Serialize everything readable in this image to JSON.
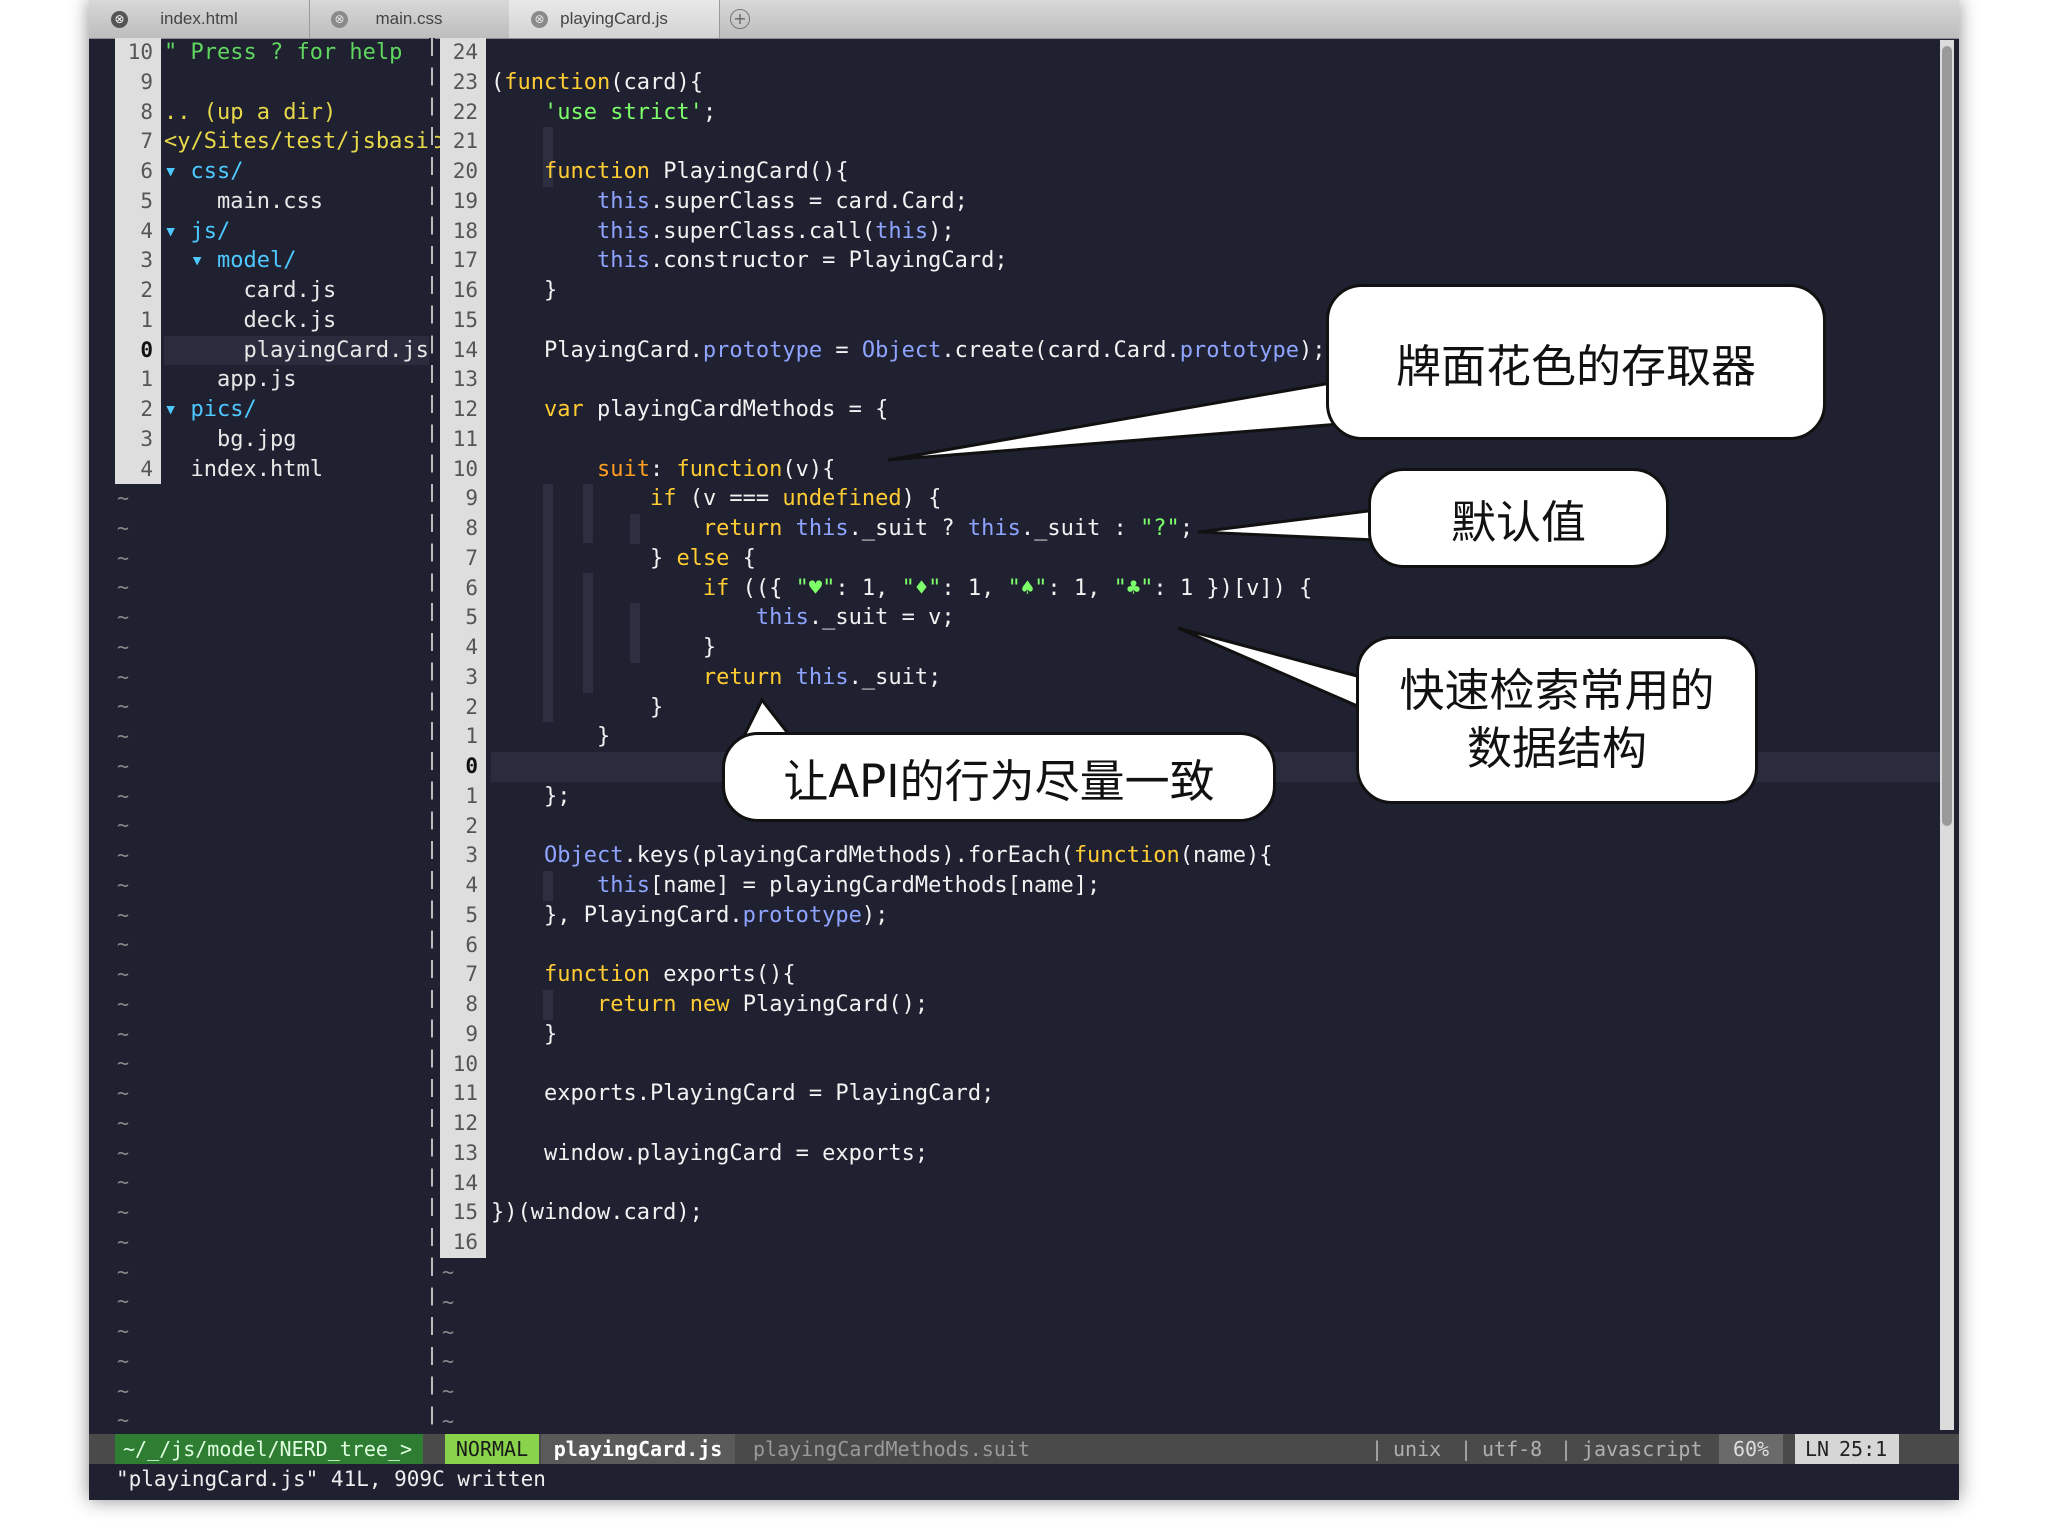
{
  "tabs": [
    {
      "label": "index.html",
      "active": false
    },
    {
      "label": "main.css",
      "active": false
    },
    {
      "label": "playingCard.js",
      "active": true
    }
  ],
  "tab_close_glyph": "⊗",
  "new_tab_glyph": "+",
  "tree": {
    "line_numbers": [
      "10",
      "9",
      "8",
      "7",
      "6",
      "5",
      "4",
      "3",
      "2",
      "1",
      "0",
      "1",
      "2",
      "3",
      "4"
    ],
    "rows": [
      {
        "text": "\" Press ? for help",
        "color": "green"
      },
      {
        "text": "",
        "color": "plain"
      },
      {
        "text": ".. (up a dir)",
        "color": "yellow"
      },
      {
        "text": "<y/Sites/test/jsbasic",
        "color": "yellow"
      },
      {
        "text": "▾ css/",
        "color": "cyan"
      },
      {
        "text": "    main.css",
        "color": "plain"
      },
      {
        "text": "▾ js/",
        "color": "cyan"
      },
      {
        "text": "  ▾ model/",
        "color": "cyan"
      },
      {
        "text": "      card.js",
        "color": "plain"
      },
      {
        "text": "      deck.js",
        "color": "plain"
      },
      {
        "text": "      playingCard.js",
        "color": "plain"
      },
      {
        "text": "    app.js",
        "color": "plain"
      },
      {
        "text": "▾ pics/",
        "color": "cyan"
      },
      {
        "text": "    bg.jpg",
        "color": "plain"
      },
      {
        "text": "  index.html",
        "color": "plain"
      }
    ]
  },
  "editor": {
    "line_numbers": [
      "24",
      "23",
      "22",
      "21",
      "20",
      "19",
      "18",
      "17",
      "16",
      "15",
      "14",
      "13",
      "12",
      "11",
      "10",
      "9",
      "8",
      "7",
      "6",
      "5",
      "4",
      "3",
      "2",
      "1",
      "0",
      "1",
      "2",
      "3",
      "4",
      "5",
      "6",
      "7",
      "8",
      "9",
      "10",
      "11",
      "12",
      "13",
      "14",
      "15",
      "16"
    ],
    "current_line_index": 24,
    "lines": [
      "",
      "(function(card){",
      "    'use strict';",
      "",
      "    function PlayingCard(){",
      "        this.superClass = card.Card;",
      "        this.superClass.call(this);",
      "        this.constructor = PlayingCard;",
      "    }",
      "",
      "    PlayingCard.prototype = Object.create(card.Card.prototype);",
      "",
      "    var playingCardMethods = {",
      "",
      "        suit: function(v){",
      "            if (v === undefined) {",
      "                return this._suit ? this._suit : \"?\";",
      "            } else {",
      "                if (({ \"♥\": 1, \"♦\": 1, \"♠\": 1, \"♣\": 1 })[v]) {",
      "                    this._suit = v;",
      "                }",
      "                return this._suit;",
      "            }",
      "        }",
      "",
      "    };",
      "",
      "    Object.keys(playingCardMethods).forEach(function(name){",
      "        this[name] = playingCardMethods[name];",
      "    }, PlayingCard.prototype);",
      "",
      "    function exports(){",
      "        return new PlayingCard();",
      "    }",
      "",
      "    exports.PlayingCard = PlayingCard;",
      "",
      "    window.playingCard = exports;",
      "",
      "})(window.card);",
      ""
    ]
  },
  "tilde": "~",
  "status": {
    "tree_path": "~/_/js/model/NERD_tree_>",
    "mode": "NORMAL",
    "file": "playingCard.js",
    "context": "playingCardMethods.suit",
    "format": "unix",
    "encoding": "utf-8",
    "filetype": "javascript",
    "percent": "60%",
    "ln_label": "LN",
    "position": "25:1",
    "separator": "|"
  },
  "command_line": "\"playingCard.js\" 41L, 909C written",
  "callouts": {
    "accessor": "牌面花色的存取器",
    "default_value": "默认值",
    "lookup_line1": "快速检索常用的",
    "lookup_line2": "数据结构",
    "api_consistency": "让API的行为尽量一致"
  },
  "colors": {
    "editor_bg": "#1f2030",
    "keyword": "#ffcc33",
    "string": "#7dff6a",
    "this": "#8fa4ff",
    "tree_dir": "#4ec9ff",
    "mode_bg": "#88d34a"
  }
}
